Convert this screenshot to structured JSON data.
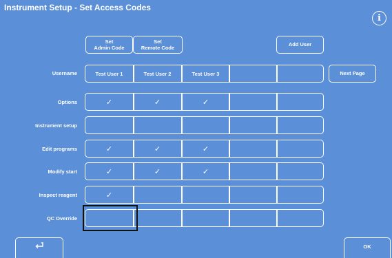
{
  "window": {
    "title": "Instrument Setup - Set Access Codes",
    "info_icon": "info-icon"
  },
  "toolbar": {
    "set_admin_line1": "Set",
    "set_admin_line2": "Admin Code",
    "set_remote_line1": "Set",
    "set_remote_line2": "Remote Code",
    "add_user": "Add User",
    "next_page": "Next Page"
  },
  "users": {
    "label": "Username",
    "cells": [
      "Test User 1",
      "Test User 2",
      "Test User 3",
      "",
      ""
    ]
  },
  "check_glyph": "✓",
  "permissions": [
    {
      "label": "Options",
      "checks": [
        "✓",
        "✓",
        "✓",
        "",
        ""
      ]
    },
    {
      "label": "Instrument setup",
      "checks": [
        "",
        "",
        "",
        "",
        ""
      ]
    },
    {
      "label": "Edit programs",
      "checks": [
        "✓",
        "✓",
        "✓",
        "",
        ""
      ]
    },
    {
      "label": "Modify start",
      "checks": [
        "✓",
        "✓",
        "✓",
        "",
        ""
      ]
    },
    {
      "label": "Inspect reagent",
      "checks": [
        "✓",
        "",
        "",
        "",
        ""
      ]
    },
    {
      "label": "QC Override",
      "checks": [
        "",
        "",
        "",
        "",
        ""
      ]
    }
  ],
  "footer": {
    "back_icon": "back-arrow-icon",
    "ok": "OK"
  },
  "colors": {
    "background": "#5b8fd8",
    "foreground": "#ffffff",
    "focus": "#111111"
  }
}
